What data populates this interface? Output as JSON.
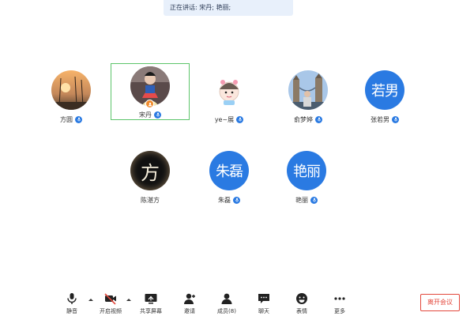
{
  "speaking_banner": "正在讲话: 宋丹; 艳丽;",
  "participants": [
    {
      "name": "方圆",
      "avatar": "photo-sunset",
      "mic": "mic-icon"
    },
    {
      "name": "宋丹",
      "avatar": "photo-costume",
      "mic": "mic-icon",
      "badge": "host-icon",
      "active": true
    },
    {
      "name": "ye~展",
      "avatar": "photo-cartoon",
      "mic": "mic-icon"
    },
    {
      "name": "俞梦婷",
      "avatar": "photo-city",
      "mic": "mic-icon"
    },
    {
      "name": "张若男",
      "avatar_text": "若男",
      "mic": "mic-icon"
    },
    {
      "name": "陈湛方",
      "avatar_text": "方"
    },
    {
      "name": "朱磊",
      "avatar_text": "朱磊",
      "mic": "mic-icon"
    },
    {
      "name": "艳丽",
      "avatar_text": "艳丽",
      "mic": "mic-icon"
    }
  ],
  "toolbar": {
    "mute": "静音",
    "video": "开启视频",
    "share": "共享屏幕",
    "invite": "邀请",
    "members": "成员(8)",
    "chat": "聊天",
    "emoji": "表情",
    "more": "更多"
  },
  "leave_button": "离开会议",
  "colors": {
    "accent": "#2a7ae2",
    "active_border": "#5cc46a",
    "leave": "#e3483c",
    "banner_bg": "#e8f0fb"
  }
}
